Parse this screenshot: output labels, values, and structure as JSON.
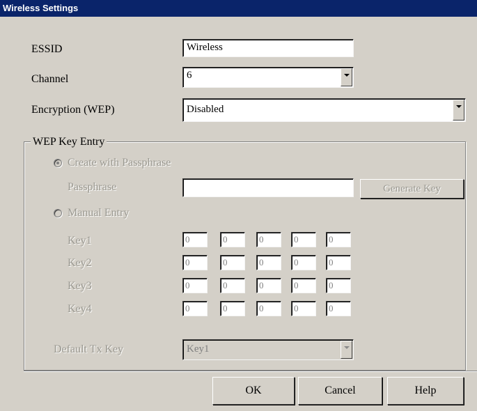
{
  "window": {
    "title": "Wireless Settings"
  },
  "essid": {
    "label": "ESSID",
    "value": "Wireless"
  },
  "channel": {
    "label": "Channel",
    "value": "6"
  },
  "encryption": {
    "label": "Encryption (WEP)",
    "value": "Disabled"
  },
  "wep": {
    "group_label": "WEP Key Entry",
    "create_with_passphrase_label": "Create with Passphrase",
    "passphrase_label": "Passphrase",
    "passphrase_value": "",
    "generate_key_label": "Generate Key",
    "manual_entry_label": "Manual Entry",
    "keys": [
      {
        "label": "Key1",
        "values": [
          "0",
          "0",
          "0",
          "0",
          "0"
        ]
      },
      {
        "label": "Key2",
        "values": [
          "0",
          "0",
          "0",
          "0",
          "0"
        ]
      },
      {
        "label": "Key3",
        "values": [
          "0",
          "0",
          "0",
          "0",
          "0"
        ]
      },
      {
        "label": "Key4",
        "values": [
          "0",
          "0",
          "0",
          "0",
          "0"
        ]
      }
    ],
    "default_tx_label": "Default Tx Key",
    "default_tx_value": "Key1"
  },
  "buttons": {
    "ok": "OK",
    "cancel": "Cancel",
    "help": "Help"
  },
  "icons": {
    "dropdown": "chevron-down-icon",
    "radio": "radio-icon"
  },
  "colors": {
    "title_bar": "#0a246a",
    "dialog_bg": "#d4d0c8",
    "disabled_text": "#9a9890"
  }
}
